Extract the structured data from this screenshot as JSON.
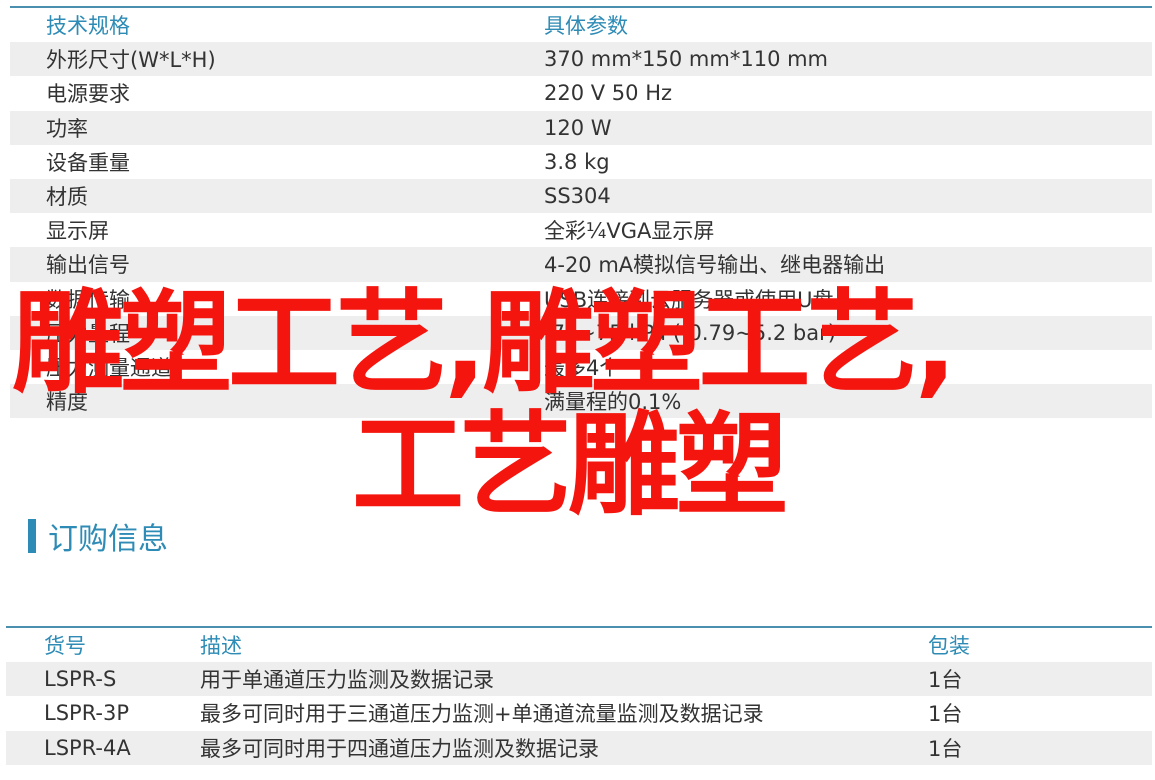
{
  "spec": {
    "header": [
      "技术规格",
      "具体参数"
    ],
    "rows": [
      [
        "外形尺寸(W*L*H)",
        "370 mm*150 mm*110 mm"
      ],
      [
        "电源要求",
        "220 V 50 Hz"
      ],
      [
        "功率",
        "120 W"
      ],
      [
        "设备重量",
        "3.8 kg"
      ],
      [
        "材质",
        "SS304"
      ],
      [
        "显示屏",
        "全彩¼VGA显示屏"
      ],
      [
        "输出信号",
        "4-20 mA模拟信号输出、继电器输出"
      ],
      [
        "数据传输",
        "USB连接到云服务器或使用U盘"
      ],
      [
        "压力量程",
        "-75~75 kPa (-0.79~5.2 bar)"
      ],
      [
        "压力测量通道",
        "最多4个"
      ],
      [
        "精度",
        "满量程的0.1%"
      ]
    ]
  },
  "watermark": {
    "line1": "雕塑工艺,雕塑工艺,",
    "line2": "工艺雕塑"
  },
  "section": {
    "title": "订购信息"
  },
  "order": {
    "header": [
      "货号",
      "描述",
      "包装"
    ],
    "rows": [
      [
        "LSPR-S",
        "用于单通道压力监测及数据记录",
        "1台"
      ],
      [
        "LSPR-3P",
        "最多可同时用于三通道压力监测+单通道流量监测及数据记录",
        "1台"
      ],
      [
        "LSPR-4A",
        "最多可同时用于四通道压力监测及数据记录",
        "1台"
      ]
    ]
  },
  "colors": {
    "accent": "#2d8bb5",
    "watermark": "#f5150f",
    "shade": "#eeeeee"
  }
}
